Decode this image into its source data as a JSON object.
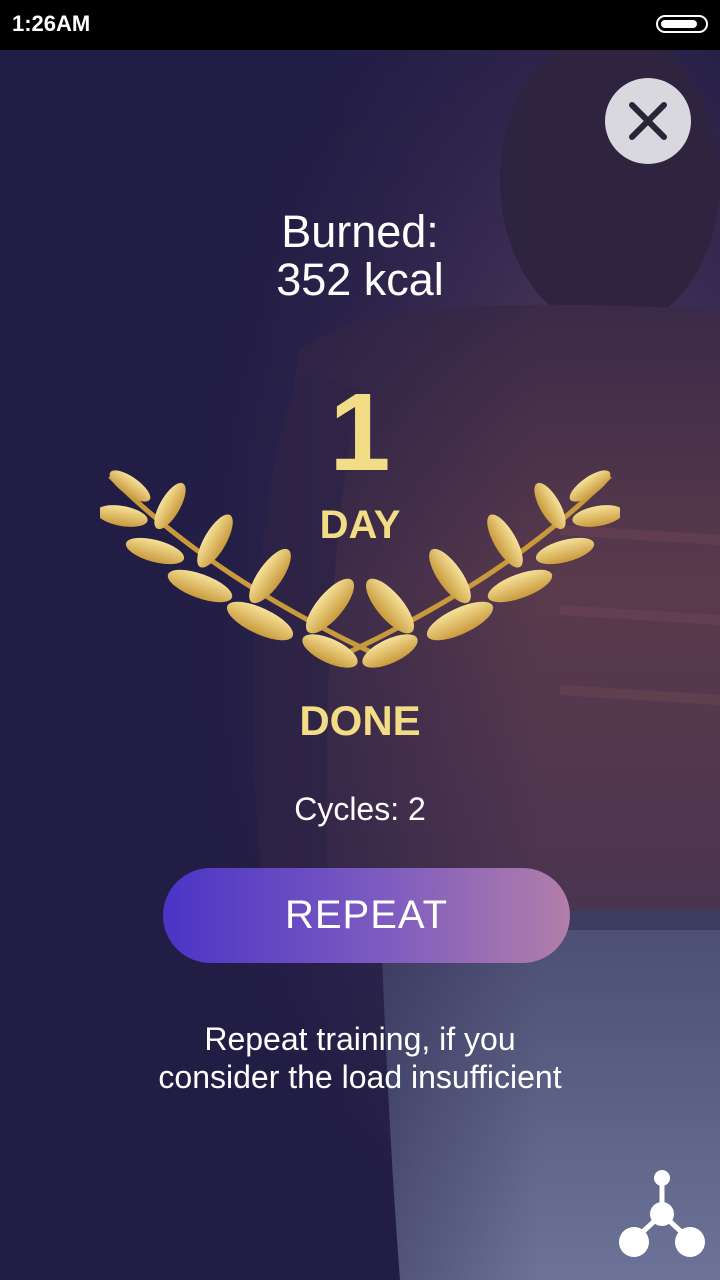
{
  "status_bar": {
    "time": "1:26AM",
    "battery_icon": "battery-icon"
  },
  "close": {
    "icon": "close-icon"
  },
  "summary": {
    "burned_label": "Burned:",
    "burned_value": "352 kcal",
    "day_number": "1",
    "day_label": "DAY",
    "done_label": "DONE",
    "cycles_text": "Cycles: 2"
  },
  "actions": {
    "repeat_label": "REPEAT"
  },
  "hint": {
    "line1": "Repeat training, if you",
    "line2": "consider the load insufficient"
  },
  "share": {
    "icon": "share-network-icon"
  },
  "colors": {
    "background": "#221d45",
    "accent_gold": "#f3dc86",
    "button_gradient_start": "#4a34c6",
    "button_gradient_end": "#b27ea9"
  }
}
